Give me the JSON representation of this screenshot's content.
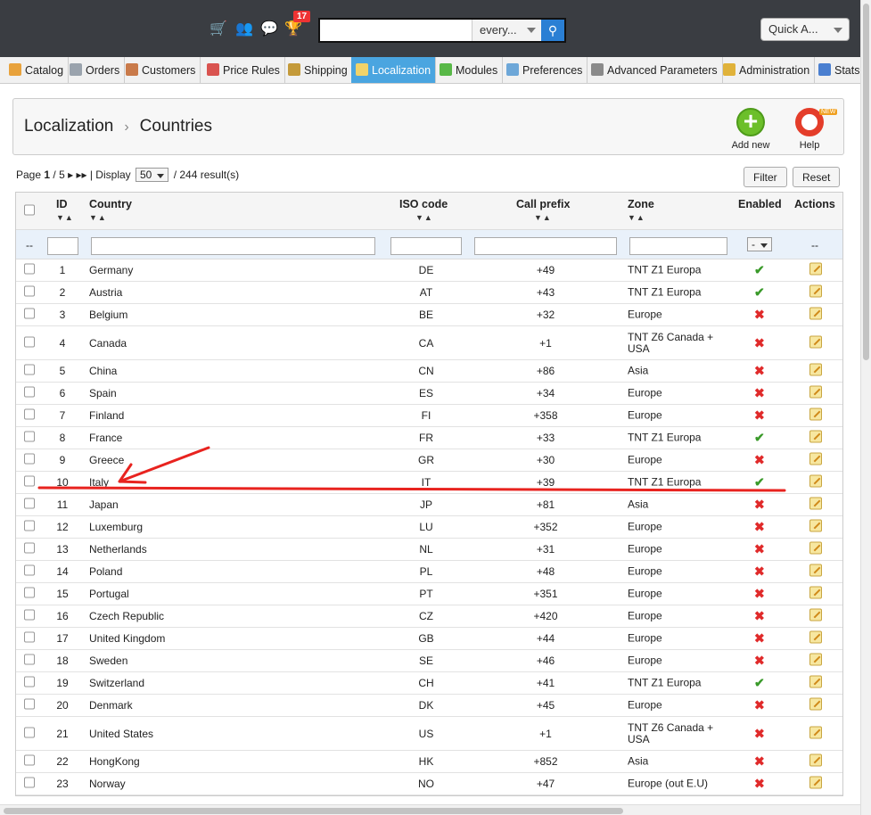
{
  "header": {
    "icons": [
      "cart-icon",
      "customers-icon",
      "messages-icon",
      "trophy-icon"
    ],
    "notification_count": "17",
    "search": {
      "value": "",
      "placeholder": "",
      "scope": "every..."
    },
    "quick_access": "Quick A..."
  },
  "nav": {
    "tabs": [
      {
        "label": "Catalog",
        "color": "#e8a23c"
      },
      {
        "label": "Orders",
        "color": "#9aa3ad"
      },
      {
        "label": "Customers",
        "color": "#c97a4a"
      },
      {
        "label": "Price Rules",
        "color": "#d9534f"
      },
      {
        "label": "Shipping",
        "color": "#c49a3a"
      },
      {
        "label": "Localization",
        "color": "#f1d36a"
      },
      {
        "label": "Modules",
        "color": "#58b847"
      },
      {
        "label": "Preferences",
        "color": "#6da7d8"
      },
      {
        "label": "Advanced Parameters",
        "color": "#8a8a8a"
      },
      {
        "label": "Administration",
        "color": "#e0b23a"
      },
      {
        "label": "Stats",
        "color": "#4a7fd0"
      }
    ],
    "active": "Localization"
  },
  "breadcrumb": {
    "section": "Localization",
    "page": "Countries"
  },
  "toolbar": {
    "add_new": "Add new",
    "help": "Help",
    "help_new": "NEW"
  },
  "pagination": {
    "page_label": "Page",
    "current": "1",
    "total": "/ 5",
    "display_label": "| Display",
    "per_page": "50",
    "results": "/ 244 result(s)"
  },
  "buttons": {
    "filter": "Filter",
    "reset": "Reset"
  },
  "table": {
    "columns": {
      "id": "ID",
      "country": "Country",
      "iso": "ISO code",
      "prefix": "Call prefix",
      "zone": "Zone",
      "enabled": "Enabled",
      "actions": "Actions"
    },
    "filter_row": {
      "dash": "--",
      "enabled_select": "-",
      "actions_dash": "--"
    },
    "rows": [
      {
        "id": "1",
        "country": "Germany",
        "iso": "DE",
        "prefix": "+49",
        "zone": "TNT Z1 Europa",
        "enabled": true
      },
      {
        "id": "2",
        "country": "Austria",
        "iso": "AT",
        "prefix": "+43",
        "zone": "TNT Z1 Europa",
        "enabled": true
      },
      {
        "id": "3",
        "country": "Belgium",
        "iso": "BE",
        "prefix": "+32",
        "zone": "Europe",
        "enabled": false
      },
      {
        "id": "4",
        "country": "Canada",
        "iso": "CA",
        "prefix": "+1",
        "zone": "TNT Z6 Canada + USA",
        "enabled": false
      },
      {
        "id": "5",
        "country": "China",
        "iso": "CN",
        "prefix": "+86",
        "zone": "Asia",
        "enabled": false
      },
      {
        "id": "6",
        "country": "Spain",
        "iso": "ES",
        "prefix": "+34",
        "zone": "Europe",
        "enabled": false
      },
      {
        "id": "7",
        "country": "Finland",
        "iso": "FI",
        "prefix": "+358",
        "zone": "Europe",
        "enabled": false
      },
      {
        "id": "8",
        "country": "France",
        "iso": "FR",
        "prefix": "+33",
        "zone": "TNT Z1 Europa",
        "enabled": true
      },
      {
        "id": "9",
        "country": "Greece",
        "iso": "GR",
        "prefix": "+30",
        "zone": "Europe",
        "enabled": false
      },
      {
        "id": "10",
        "country": "Italy",
        "iso": "IT",
        "prefix": "+39",
        "zone": "TNT Z1 Europa",
        "enabled": true
      },
      {
        "id": "11",
        "country": "Japan",
        "iso": "JP",
        "prefix": "+81",
        "zone": "Asia",
        "enabled": false
      },
      {
        "id": "12",
        "country": "Luxemburg",
        "iso": "LU",
        "prefix": "+352",
        "zone": "Europe",
        "enabled": false
      },
      {
        "id": "13",
        "country": "Netherlands",
        "iso": "NL",
        "prefix": "+31",
        "zone": "Europe",
        "enabled": false
      },
      {
        "id": "14",
        "country": "Poland",
        "iso": "PL",
        "prefix": "+48",
        "zone": "Europe",
        "enabled": false
      },
      {
        "id": "15",
        "country": "Portugal",
        "iso": "PT",
        "prefix": "+351",
        "zone": "Europe",
        "enabled": false
      },
      {
        "id": "16",
        "country": "Czech Republic",
        "iso": "CZ",
        "prefix": "+420",
        "zone": "Europe",
        "enabled": false
      },
      {
        "id": "17",
        "country": "United Kingdom",
        "iso": "GB",
        "prefix": "+44",
        "zone": "Europe",
        "enabled": false
      },
      {
        "id": "18",
        "country": "Sweden",
        "iso": "SE",
        "prefix": "+46",
        "zone": "Europe",
        "enabled": false
      },
      {
        "id": "19",
        "country": "Switzerland",
        "iso": "CH",
        "prefix": "+41",
        "zone": "TNT Z1 Europa",
        "enabled": true
      },
      {
        "id": "20",
        "country": "Denmark",
        "iso": "DK",
        "prefix": "+45",
        "zone": "Europe",
        "enabled": false
      },
      {
        "id": "21",
        "country": "United States",
        "iso": "US",
        "prefix": "+1",
        "zone": "TNT Z6 Canada + USA",
        "enabled": false
      },
      {
        "id": "22",
        "country": "HongKong",
        "iso": "HK",
        "prefix": "+852",
        "zone": "Asia",
        "enabled": false
      },
      {
        "id": "23",
        "country": "Norway",
        "iso": "NO",
        "prefix": "+47",
        "zone": "Europe (out E.U)",
        "enabled": false
      }
    ]
  },
  "annotation": {
    "color": "#e8231f"
  }
}
